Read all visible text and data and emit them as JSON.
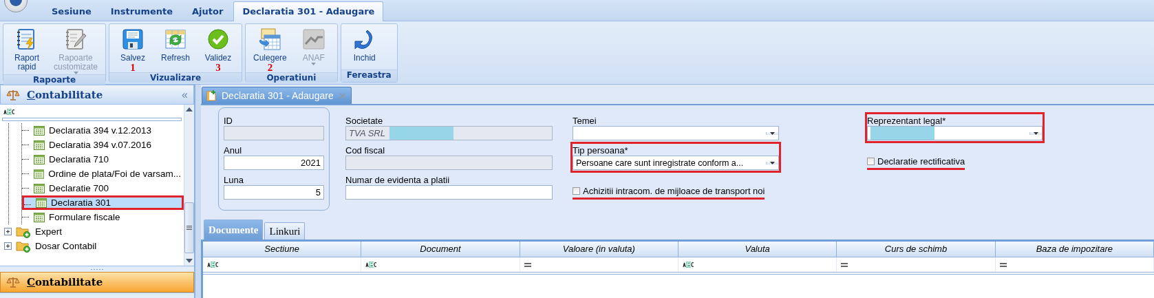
{
  "app_menu": {
    "tabs": [
      {
        "label": "Sesiune",
        "selected": false
      },
      {
        "label": "Instrumente",
        "selected": false
      },
      {
        "label": "Ajutor",
        "selected": false
      },
      {
        "label": "Declaratia 301 - Adaugare",
        "selected": true
      }
    ]
  },
  "ribbon": {
    "groups": [
      {
        "label": "Rapoarte",
        "buttons": [
          {
            "label": "Raport\nrapid",
            "disabled": false,
            "dropdown": false
          },
          {
            "label": "Rapoarte\ncustomizate",
            "disabled": true,
            "dropdown": true
          }
        ]
      },
      {
        "label": "Vizualizare",
        "buttons": [
          {
            "label": "Salvez",
            "disabled": false,
            "dropdown": false,
            "annotation": "1"
          },
          {
            "label": "Refresh",
            "disabled": false,
            "dropdown": false
          },
          {
            "label": "Validez",
            "disabled": false,
            "dropdown": false,
            "annotation": "3"
          }
        ]
      },
      {
        "label": "Operatiuni",
        "buttons": [
          {
            "label": "Culegere",
            "disabled": false,
            "dropdown": false,
            "annotation": "2"
          },
          {
            "label": "ANAF",
            "disabled": true,
            "dropdown": true
          }
        ]
      },
      {
        "label": "Fereastra",
        "buttons": [
          {
            "label": "Inchid",
            "disabled": false,
            "dropdown": false
          }
        ]
      }
    ]
  },
  "sidebar": {
    "title": "Contabilitate",
    "collapse": "«",
    "tree": [
      {
        "children": [
          {
            "label": "Declaratia 394 v.12.2013",
            "selected": false,
            "highlighted": false
          },
          {
            "label": "Declaratia 394 v.07.2016",
            "selected": false,
            "highlighted": false
          },
          {
            "label": "Declaratia 710",
            "selected": false,
            "highlighted": false
          },
          {
            "label": "Ordine de plata/Foi de varsam...",
            "selected": false,
            "highlighted": false
          },
          {
            "label": "Declaratie 700",
            "selected": false,
            "highlighted": false
          },
          {
            "label": "Declaratia 301",
            "selected": true,
            "highlighted": true
          },
          {
            "label": "Formulare fiscale",
            "selected": false,
            "highlighted": false
          }
        ]
      },
      {
        "label": "Expert",
        "expanded": false
      },
      {
        "label": "Dosar Contabil",
        "expanded": false
      }
    ],
    "nav_header": {
      "title": "Contabilitate"
    }
  },
  "document_tab": {
    "title": "Declaratia 301 - Adaugare"
  },
  "form": {
    "columns": [
      {
        "grouped": true,
        "fields": [
          {
            "kind": "text",
            "label": "ID",
            "readonly": true
          },
          {
            "kind": "number",
            "label": "Anul",
            "value": "2021",
            "readonly": false
          },
          {
            "kind": "number",
            "label": "Luna",
            "value": "5",
            "readonly": false
          }
        ]
      },
      {
        "grouped": false,
        "fields": [
          {
            "kind": "text",
            "label": "Societate",
            "value": "TVA SRL",
            "readonly": true,
            "redacted": true
          },
          {
            "kind": "text",
            "label": "Cod fiscal",
            "readonly": true
          },
          {
            "kind": "text",
            "label": "Numar de evidenta a platii",
            "readonly": false
          }
        ]
      },
      {
        "grouped": false,
        "fields": [
          {
            "kind": "combo",
            "label": "Temei",
            "highlighted": false
          },
          {
            "kind": "combo",
            "label": "Tip persoana*",
            "value": "Persoane care sunt inregistrate conform a...",
            "highlighted": true
          },
          {
            "kind": "checkbox",
            "label": "Achizitii intracom. de mijloace de transport noi",
            "checked": false,
            "underlined": true
          }
        ]
      },
      {
        "grouped": false,
        "fields": [
          {
            "kind": "combo",
            "label": "Reprezentant legal*",
            "highlighted": true,
            "redacted": true
          },
          {
            "kind": "checkbox",
            "label": "Declaratie rectificativa",
            "checked": false,
            "underlined": true
          }
        ]
      }
    ]
  },
  "detail_tabs": [
    {
      "label": "Documente",
      "selected": true
    },
    {
      "label": "Linkuri",
      "selected": false
    }
  ],
  "grid": {
    "columns": [
      {
        "label": "Sectiune",
        "kind": "text"
      },
      {
        "label": "Document",
        "kind": "text"
      },
      {
        "label": "Valoare (in valuta)",
        "kind": "number"
      },
      {
        "label": "Valuta",
        "kind": "text"
      },
      {
        "label": "Curs de schimb",
        "kind": "number"
      },
      {
        "label": "Baza de impozitare",
        "kind": "number"
      }
    ]
  }
}
